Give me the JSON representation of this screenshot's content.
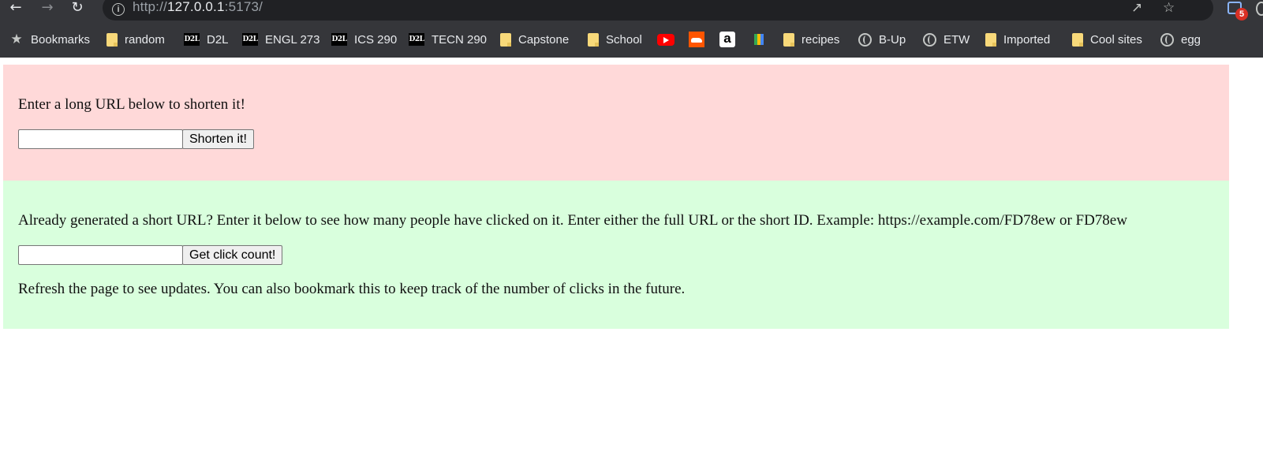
{
  "browser": {
    "url_scheme": "http://",
    "url_host": "127.0.0.1",
    "url_path": ":5173/",
    "extension_badge": "5",
    "bookmarks": [
      {
        "label": "Bookmarks",
        "icon": "star-icon"
      },
      {
        "label": "random",
        "icon": "folder-icon"
      },
      {
        "label": "D2L",
        "icon": "d2l-icon"
      },
      {
        "label": "ENGL 273",
        "icon": "d2l-icon"
      },
      {
        "label": "ICS 290",
        "icon": "d2l-icon"
      },
      {
        "label": "TECN 290",
        "icon": "d2l-icon"
      },
      {
        "label": "Capstone",
        "icon": "folder-icon"
      },
      {
        "label": "School",
        "icon": "folder-icon"
      },
      {
        "label": "",
        "icon": "youtube-icon"
      },
      {
        "label": "",
        "icon": "soundcloud-icon"
      },
      {
        "label": "",
        "icon": "amazon-icon"
      },
      {
        "label": "",
        "icon": "gift-icon"
      },
      {
        "label": "recipes",
        "icon": "folder-icon"
      },
      {
        "label": "B-Up",
        "icon": "globe-icon"
      },
      {
        "label": "ETW",
        "icon": "globe-icon"
      },
      {
        "label": "Imported",
        "icon": "folder-icon"
      },
      {
        "label": "Cool sites",
        "icon": "folder-icon"
      },
      {
        "label": "egg",
        "icon": "globe-icon"
      }
    ]
  },
  "shorten": {
    "prompt": "Enter a long URL below to shorten it!",
    "input_value": "",
    "button_label": "Shorten it!",
    "background": "#ffd9d9"
  },
  "clicks": {
    "prompt": "Already generated a short URL? Enter it below to see how many people have clicked on it. Enter either the full URL or the short ID. Example: https://example.com/FD78ew or FD78ew",
    "input_value": "",
    "button_label": "Get click count!",
    "note": "Refresh the page to see updates. You can also bookmark this to keep track of the number of clicks in the future.",
    "background": "#d9ffdd"
  }
}
